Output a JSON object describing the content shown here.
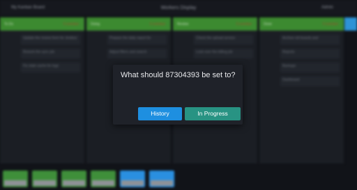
{
  "background": {
    "header": {
      "left": "My Kanban Board",
      "title": "Workers Display",
      "right": "Admin"
    },
    "columns": [
      {
        "head_left": "To Do",
        "head_right": "0 overdue",
        "items": [
          "Update the review form for Jenkins",
          "Rework the sync job",
          "Fix stale cache for logs"
        ]
      },
      {
        "head_left": "Doing",
        "head_right": "0 overdue",
        "items": [
          "Prepare the daily report for",
          "Adjust filters and search"
        ]
      },
      {
        "head_left": "Review",
        "head_right": "0 overdue",
        "items": [
          "Check the upload service",
          "Look over the billing job"
        ]
      },
      {
        "head_left": "Done",
        "head_right": "0 overdue",
        "items": [
          "Archive old boards and",
          "Reports",
          "Backups",
          "Dashboard"
        ]
      }
    ]
  },
  "dialog": {
    "question": "What should 87304393 be set to?",
    "buttons": {
      "history": "History",
      "in_progress": "In Progress"
    }
  },
  "colors": {
    "history_button": "#1e8fe0",
    "in_progress_button": "#289383",
    "column_header": "#3c8a30",
    "dialog_bg": "#1f2229"
  }
}
